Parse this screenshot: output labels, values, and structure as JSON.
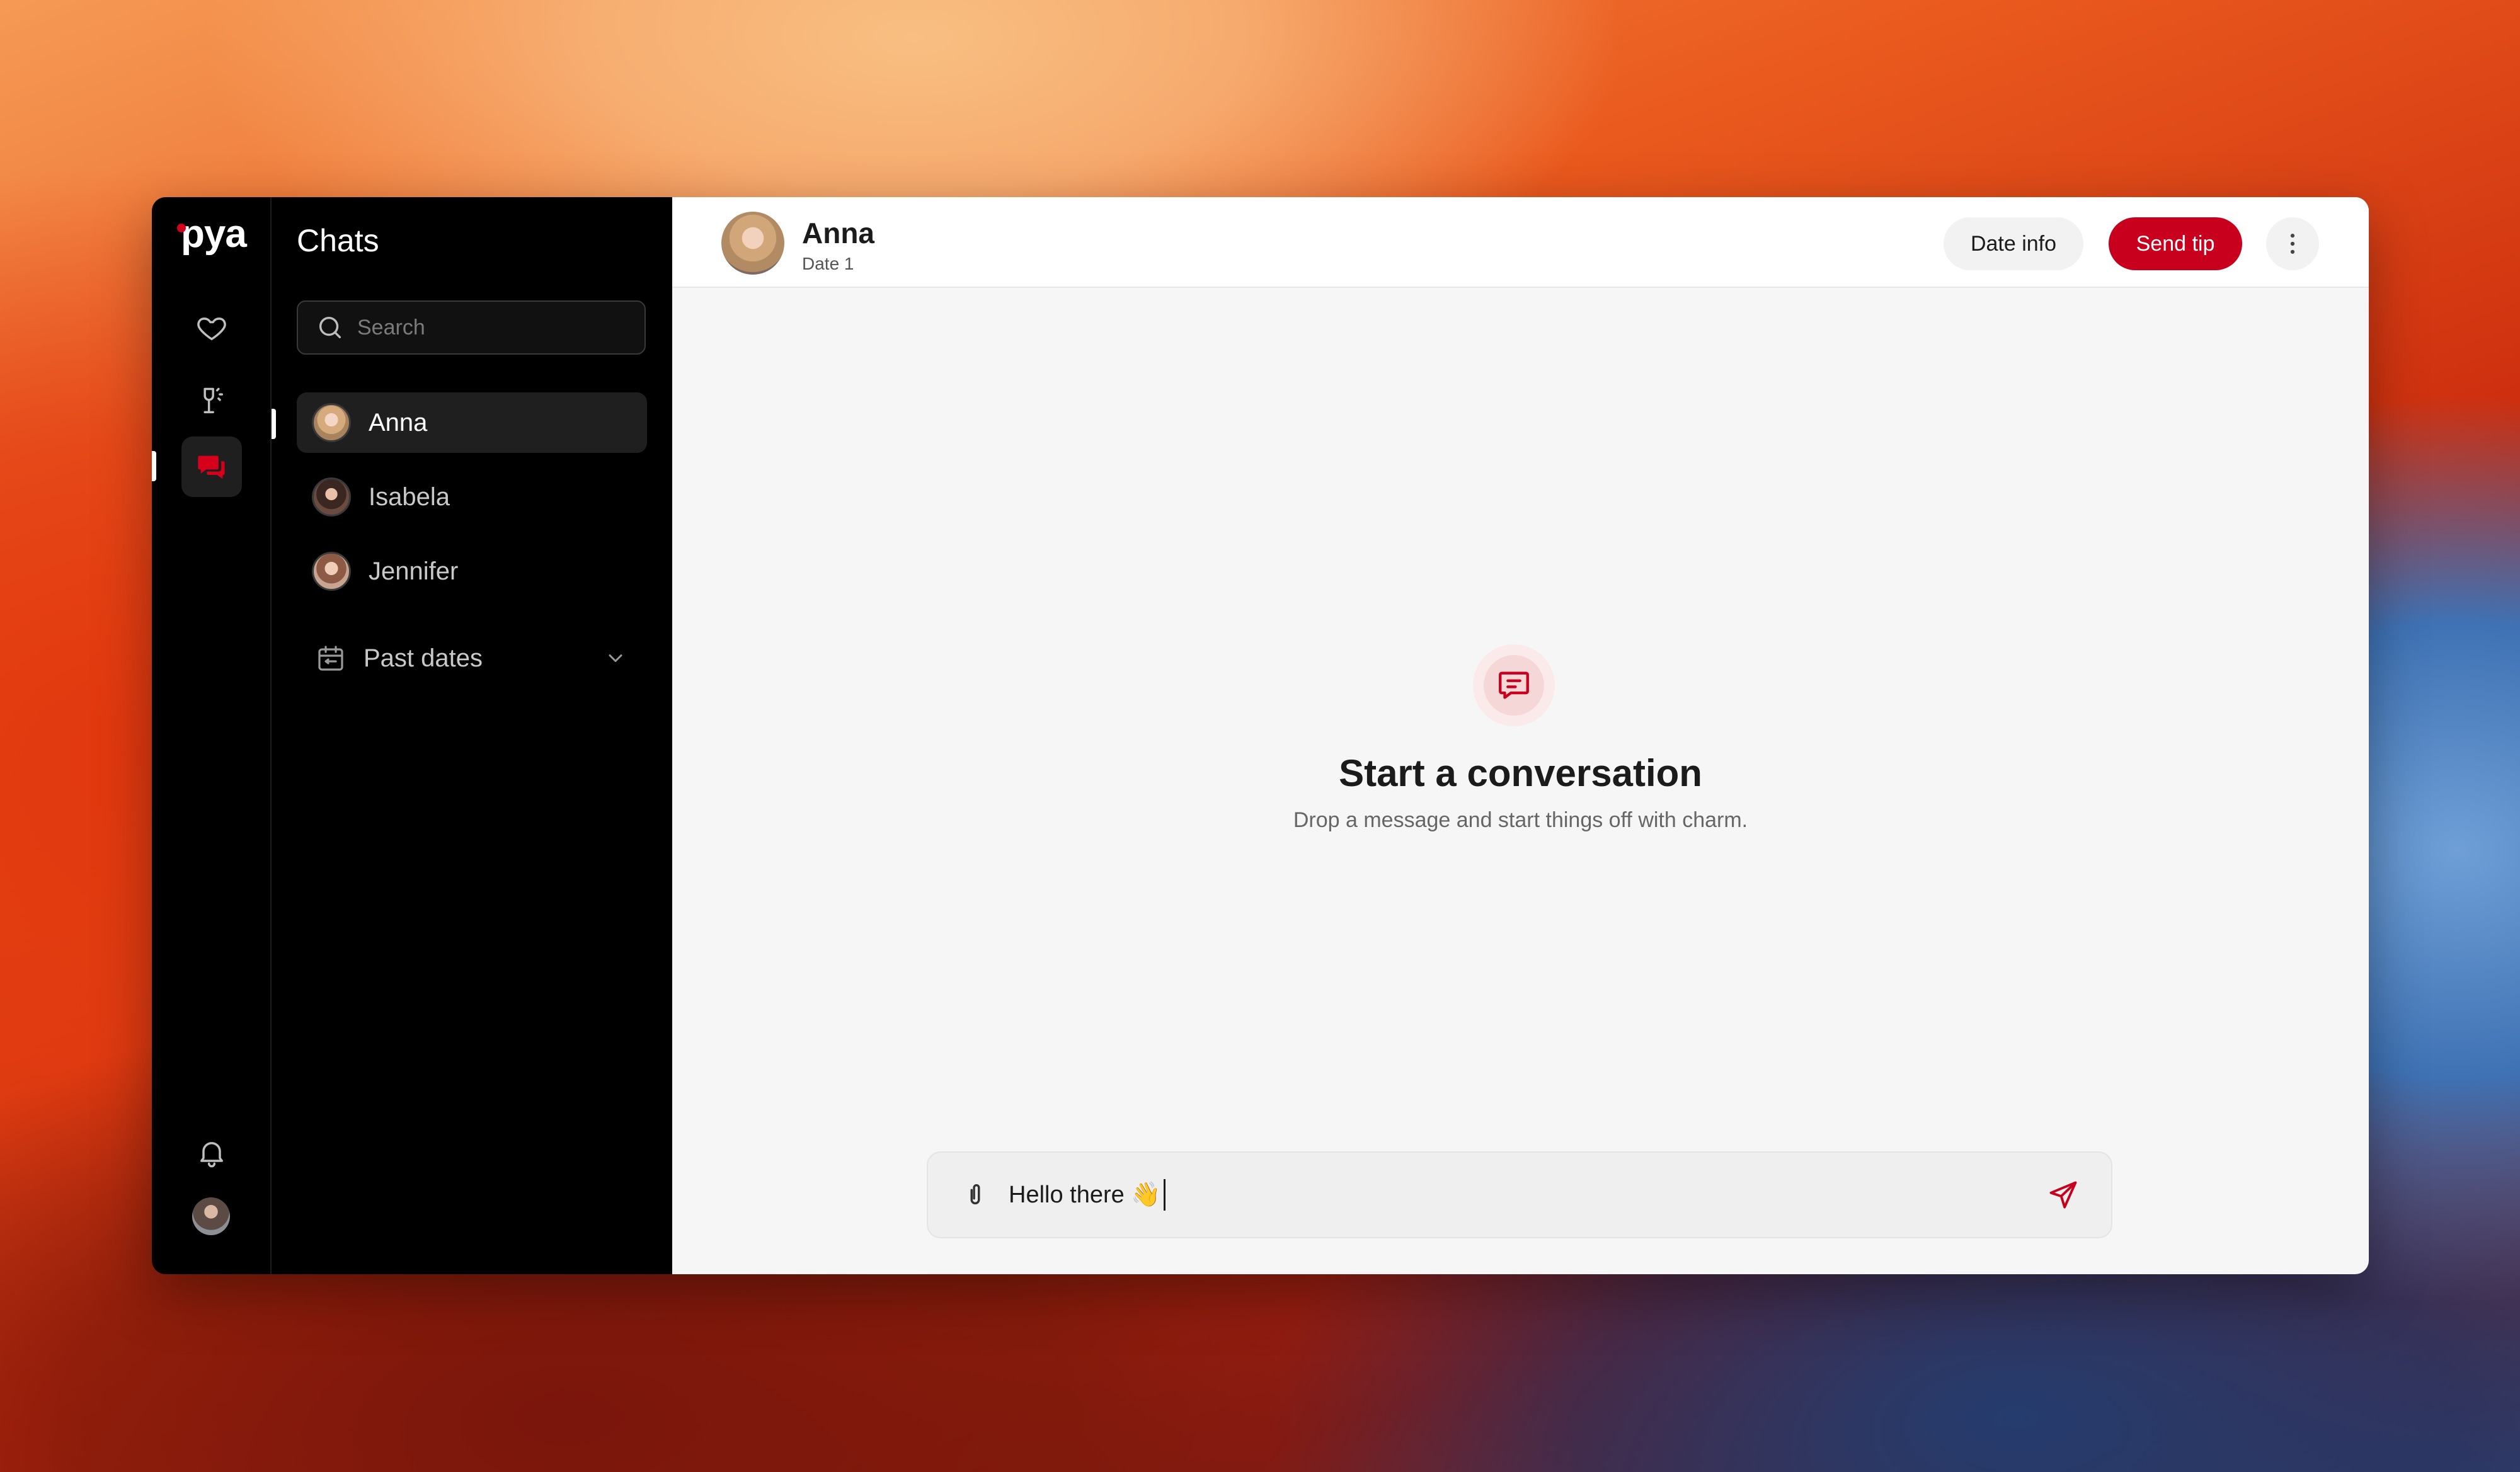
{
  "app": {
    "logo": "pya",
    "accent_color": "#c8001d",
    "rail": {
      "items": [
        {
          "icon": "heart-icon"
        },
        {
          "icon": "champagne-icon"
        },
        {
          "icon": "chat-bubbles-icon",
          "active": true
        }
      ],
      "bottom": [
        {
          "icon": "bell-icon"
        },
        {
          "icon": "user-avatar"
        }
      ]
    }
  },
  "chats": {
    "title": "Chats",
    "search": {
      "placeholder": "Search",
      "value": ""
    },
    "items": [
      {
        "name": "Anna",
        "selected": true
      },
      {
        "name": "Isabela",
        "selected": false
      },
      {
        "name": "Jennifer",
        "selected": false
      }
    ],
    "past_dates": {
      "label": "Past dates",
      "icon": "calendar-icon"
    }
  },
  "conversation": {
    "header": {
      "name": "Anna",
      "subtitle": "Date 1",
      "date_info_label": "Date info",
      "send_tip_label": "Send tip"
    },
    "empty_state": {
      "title": "Start a conversation",
      "subtitle": "Drop a message and start things off with charm."
    },
    "composer": {
      "value": "Hello there 👋"
    }
  }
}
